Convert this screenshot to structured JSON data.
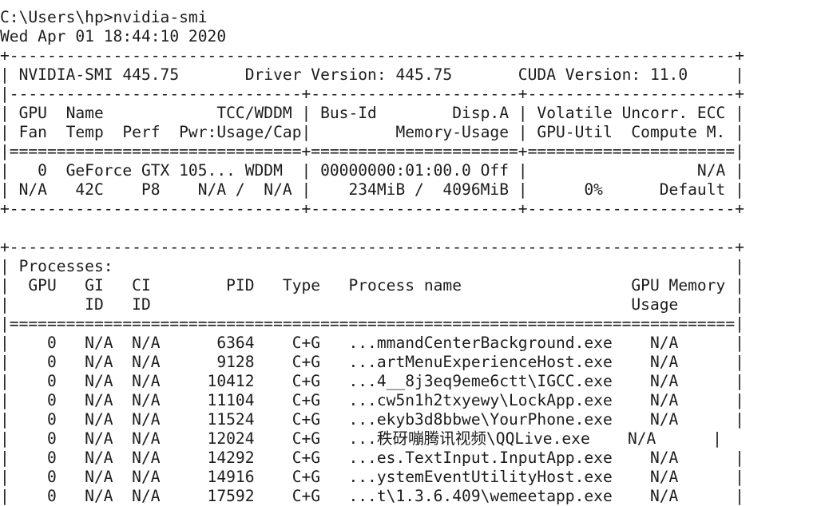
{
  "console": {
    "lines": [
      {
        "name": "prompt-command",
        "text": "C:\\Users\\hp>nvidia-smi"
      },
      {
        "name": "timestamp",
        "text": "Wed Apr 01 18:44:10 2020"
      },
      {
        "name": "top-border",
        "text": "+-----------------------------------------------------------------------------+"
      },
      {
        "name": "version-line",
        "text": "| NVIDIA-SMI 445.75       Driver Version: 445.75       CUDA Version: 11.0     |"
      },
      {
        "name": "header-separator",
        "text": "|-------------------------------+----------------------+----------------------+"
      },
      {
        "name": "gpu-header-row-1",
        "text": "| GPU  Name            TCC/WDDM | Bus-Id        Disp.A | Volatile Uncorr. ECC |"
      },
      {
        "name": "gpu-header-row-2",
        "text": "| Fan  Temp  Perf  Pwr:Usage/Cap|         Memory-Usage | GPU-Util  Compute M. |"
      },
      {
        "name": "gpu-header-double-border",
        "text": "|===============================+======================+======================|"
      },
      {
        "name": "gpu-row-1",
        "text": "|   0  GeForce GTX 105... WDDM  | 00000000:01:00.0 Off |                  N/A |"
      },
      {
        "name": "gpu-row-2",
        "text": "| N/A   42C    P8    N/A /  N/A |    234MiB /  4096MiB |      0%      Default |"
      },
      {
        "name": "gpu-bottom-border",
        "text": "+-------------------------------+----------------------+----------------------+"
      },
      {
        "name": "blank-line",
        "text": ""
      },
      {
        "name": "processes-top-border",
        "text": "+-----------------------------------------------------------------------------+"
      },
      {
        "name": "processes-title",
        "text": "| Processes:                                                                  |"
      },
      {
        "name": "processes-header-row-1",
        "text": "|  GPU   GI   CI        PID   Type   Process name                  GPU Memory |"
      },
      {
        "name": "processes-header-row-2",
        "text": "|        ID   ID                                                   Usage      |"
      },
      {
        "name": "processes-double-border",
        "text": "|=============================================================================|"
      },
      {
        "name": "process-row",
        "text": "|    0   N/A  N/A      6364    C+G   ...mmandCenterBackground.exe    N/A      |"
      },
      {
        "name": "process-row",
        "text": "|    0   N/A  N/A      9128    C+G   ...artMenuExperienceHost.exe    N/A      |"
      },
      {
        "name": "process-row",
        "text": "|    0   N/A  N/A     10412    C+G   ...4__8j3eq9eme6ctt\\IGCC.exe    N/A      |"
      },
      {
        "name": "process-row",
        "text": "|    0   N/A  N/A     11104    C+G   ...cw5n1h2txyewy\\LockApp.exe    N/A      |"
      },
      {
        "name": "process-row",
        "text": "|    0   N/A  N/A     11524    C+G   ...ekyb3d8bbwe\\YourPhone.exe    N/A      |"
      },
      {
        "name": "process-row",
        "text": "|    0   N/A  N/A     12024    C+G   ...秩砑嘣腾讯视频\\QQLive.exe    N/A      |"
      },
      {
        "name": "process-row",
        "text": "|    0   N/A  N/A     14292    C+G   ...es.TextInput.InputApp.exe    N/A      |"
      },
      {
        "name": "process-row",
        "text": "|    0   N/A  N/A     14916    C+G   ...ystemEventUtilityHost.exe    N/A      |"
      },
      {
        "name": "process-row",
        "text": "|    0   N/A  N/A     17592    C+G   ...t\\1.3.6.409\\wemeetapp.exe    N/A      |"
      }
    ]
  }
}
